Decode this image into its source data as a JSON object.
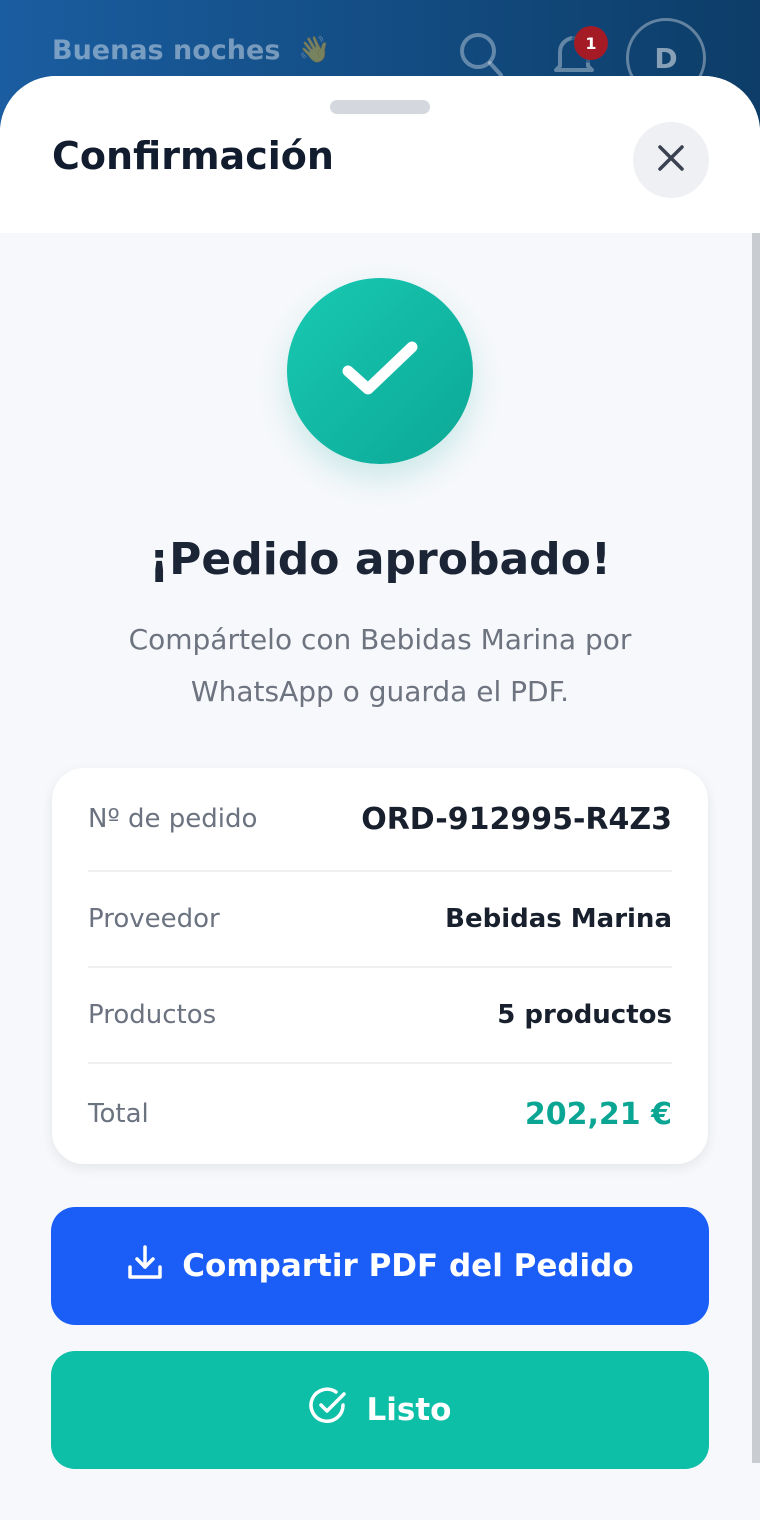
{
  "header": {
    "greeting": "Buenas noches",
    "wave_emoji": "👋",
    "notification_count": "1",
    "avatar_initial": "D"
  },
  "sheet": {
    "title": "Confirmación"
  },
  "confirmation": {
    "headline": "¡Pedido aprobado!",
    "subtitle": "Compártelo con Bebidas Marina por WhatsApp o guarda el PDF."
  },
  "order": {
    "rows": [
      {
        "label": "Nº de pedido",
        "value": "ORD-912995-R4Z3"
      },
      {
        "label": "Proveedor",
        "value": "Bebidas Marina"
      },
      {
        "label": "Productos",
        "value": "5 productos"
      },
      {
        "label": "Total",
        "value": "202,21 €"
      }
    ]
  },
  "actions": {
    "share_pdf_label": "Compartir PDF del Pedido",
    "done_label": "Listo"
  },
  "colors": {
    "primary_blue": "#1b5df7",
    "teal": "#0cbfa6",
    "total_green": "#0aa693",
    "badge_red": "#a41b26"
  },
  "icons": [
    "search-icon",
    "bell-icon",
    "close-icon",
    "check-icon",
    "download-icon",
    "check-circle-icon"
  ]
}
